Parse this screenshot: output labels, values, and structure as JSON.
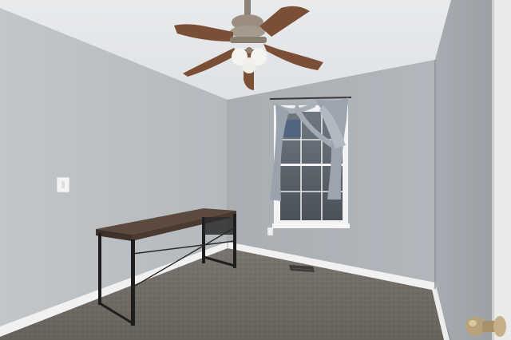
{
  "scene": {
    "kind": "photo",
    "subject": "empty-bedroom",
    "colors": {
      "ceiling": "#e4e6e8",
      "wall_left": "#b9bdc1",
      "wall_back": "#acb1b6",
      "wall_right": "#a3a8ad",
      "carpet": "#6f6964",
      "baseboard": "#f2f2f2",
      "desk_top": "#5c4a3e",
      "desk_frame": "#1e1e1e",
      "fan_blade": "#7a4f36",
      "fan_metal": "#9b8e80",
      "curtain": "#9aa3ad",
      "door": "#e9eaea",
      "knob": "#b9a27a"
    },
    "objects": [
      "ceiling-fan",
      "window",
      "curtain",
      "desk",
      "light-switch",
      "outlet",
      "floor-vent",
      "door",
      "door-knob"
    ]
  }
}
